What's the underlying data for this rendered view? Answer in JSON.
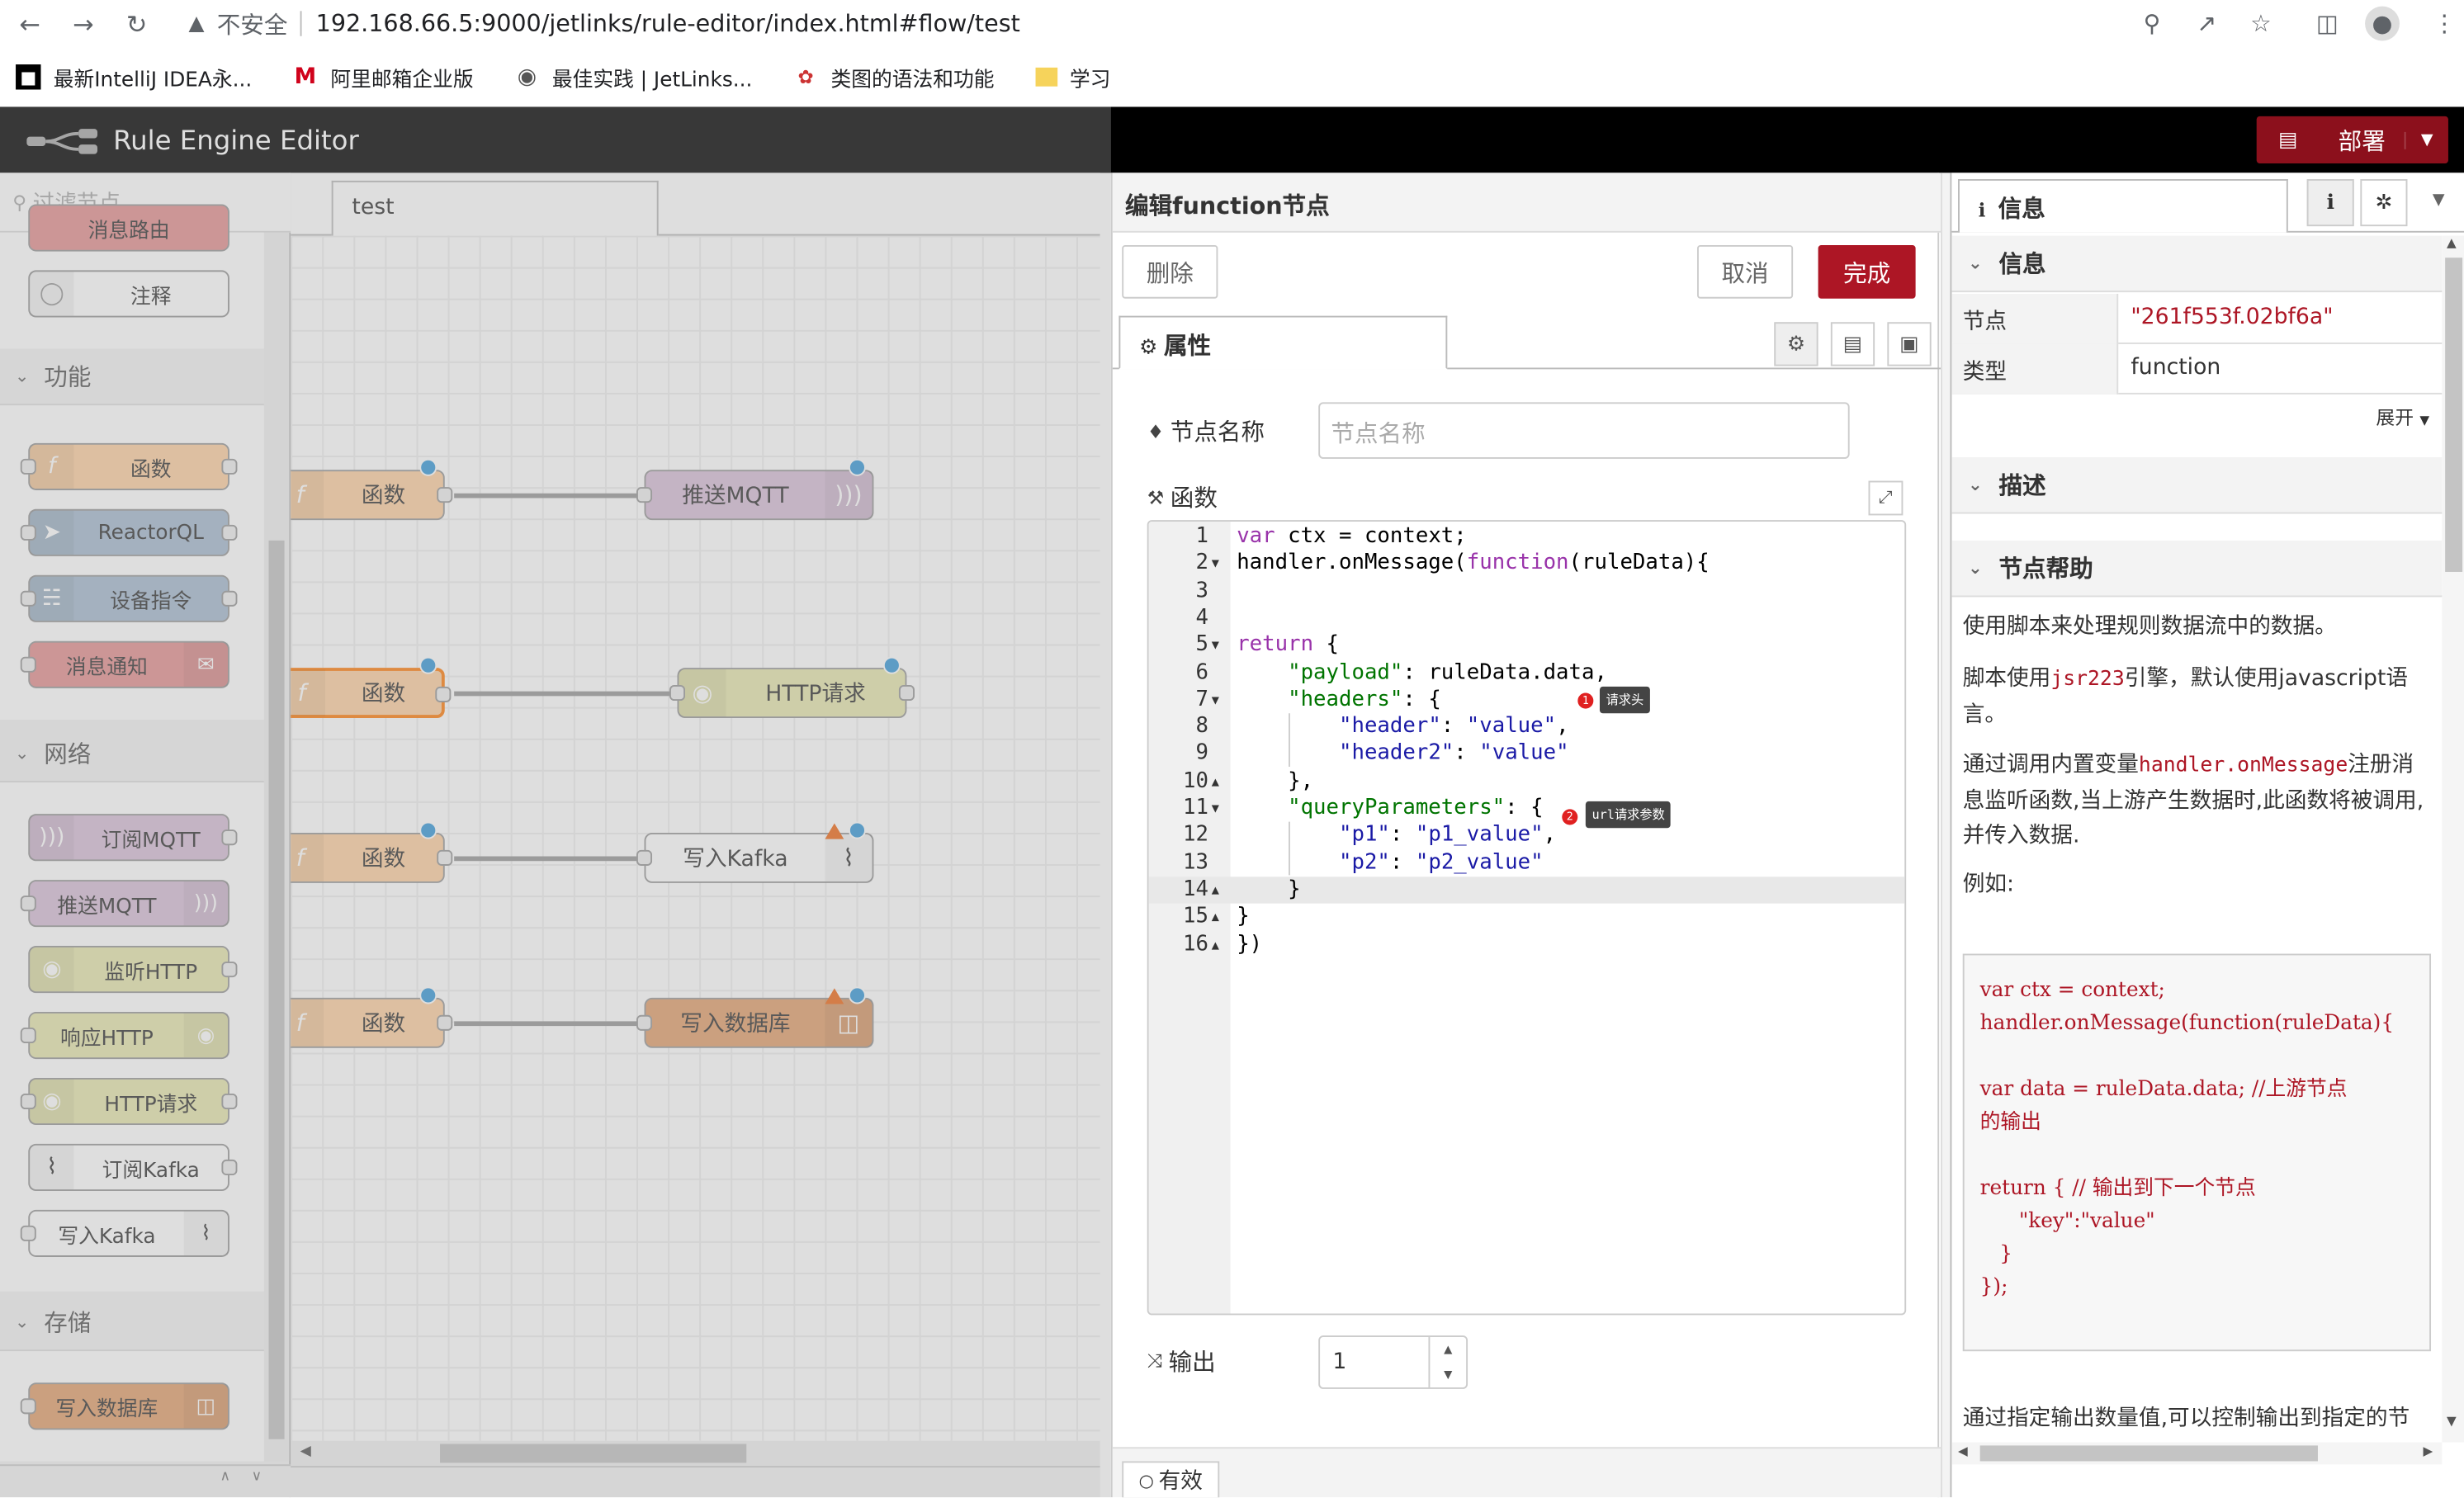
{
  "browser": {
    "insecure_label": "不安全",
    "url": "192.168.66.5:9000/jetlinks/rule-editor/index.html#flow/test",
    "bookmarks": [
      "最新IntelliJ IDEA永...",
      "阿里邮箱企业版",
      "最佳实践 | JetLinks...",
      "类图的语法和功能",
      "学习"
    ]
  },
  "app": {
    "title": "Rule Engine Editor",
    "deploy_label": "部署"
  },
  "palette": {
    "search_placeholder": "过滤节点",
    "top_partial_label": "消息路由",
    "comment_label": "注释",
    "categories": {
      "function": "功能",
      "network": "网络",
      "storage": "存储"
    },
    "function_nodes": [
      "函数",
      "ReactorQL",
      "设备指令",
      "消息通知"
    ],
    "network_nodes": [
      "订阅MQTT",
      "推送MQTT",
      "监听HTTP",
      "响应HTTP",
      "HTTP请求",
      "订阅Kafka",
      "写入Kafka"
    ],
    "storage_nodes": [
      "写入数据库"
    ]
  },
  "workspace": {
    "tab_label": "test",
    "flows": [
      {
        "source": "函数",
        "target": "推送MQTT"
      },
      {
        "source": "函数",
        "target": "HTTP请求"
      },
      {
        "source": "函数",
        "target": "写入Kafka"
      },
      {
        "source": "函数",
        "target": "写入数据库"
      }
    ]
  },
  "editor": {
    "title": "编辑function节点",
    "delete_label": "删除",
    "cancel_label": "取消",
    "done_label": "完成",
    "tab_label": "属性",
    "name_label": "节点名称",
    "name_placeholder": "节点名称",
    "func_label": "函数",
    "outputs_label": "输出",
    "outputs_value": "1",
    "valid_label": "有效",
    "code_lines": [
      "var ctx = context;",
      "handler.onMessage(function(ruleData){",
      "",
      "",
      "return {",
      "    \"payload\": ruleData.data,",
      "    \"headers\": {",
      "        \"header\": \"value\",",
      "        \"header2\": \"value\"",
      "    },",
      "    \"queryParameters\": {",
      "        \"p1\": \"p1_value\",",
      "        \"p2\": \"p2_value\"",
      "    }",
      "}",
      "})"
    ],
    "annotations": [
      {
        "marker": "1",
        "label": "请求头"
      },
      {
        "marker": "2",
        "label": "url请求参数"
      }
    ]
  },
  "sidebar": {
    "tab_label": "信息",
    "info_section": "信息",
    "node_key": "节点",
    "node_value": "\"261f553f.02bf6a\"",
    "type_key": "类型",
    "type_value": "function",
    "expand_label": "展开",
    "desc_section": "描述",
    "help_section": "节点帮助",
    "help_p1": "使用脚本来处理规则数据流中的数据。",
    "help_p2_a": "脚本使用",
    "help_p2_code": "jsr223",
    "help_p2_b": "引擎，默认使用javascript语言。",
    "help_p3_a": "通过调用内置变量",
    "help_p3_code": "handler.onMessage",
    "help_p3_b": "注册消息监听函数,当上游产生数据时,此函数将被调用,并传入数据.",
    "help_p4": "例如:",
    "example_code": "var ctx = context;\nhandler.onMessage(function(ruleData){\n\nvar data = ruleData.data; //上游节点\n的输出\n\nreturn { // 输出到下一个节点\n      \"key\":\"value\"\n   }\n});",
    "help_p5": "通过指定输出数量值,可以控制输出到指定的节"
  },
  "colors": {
    "function_node": "#fdd0a2",
    "reactorql_node": "#a6bbcf",
    "mqtt_node": "#d8bfd8",
    "http_node": "#e7e7ae",
    "kafka_node": "#ffffff",
    "database_node": "#e2a06d",
    "notify_node": "#e49191",
    "primary": "#ad1625",
    "port_selected": "#3a9ad9"
  }
}
